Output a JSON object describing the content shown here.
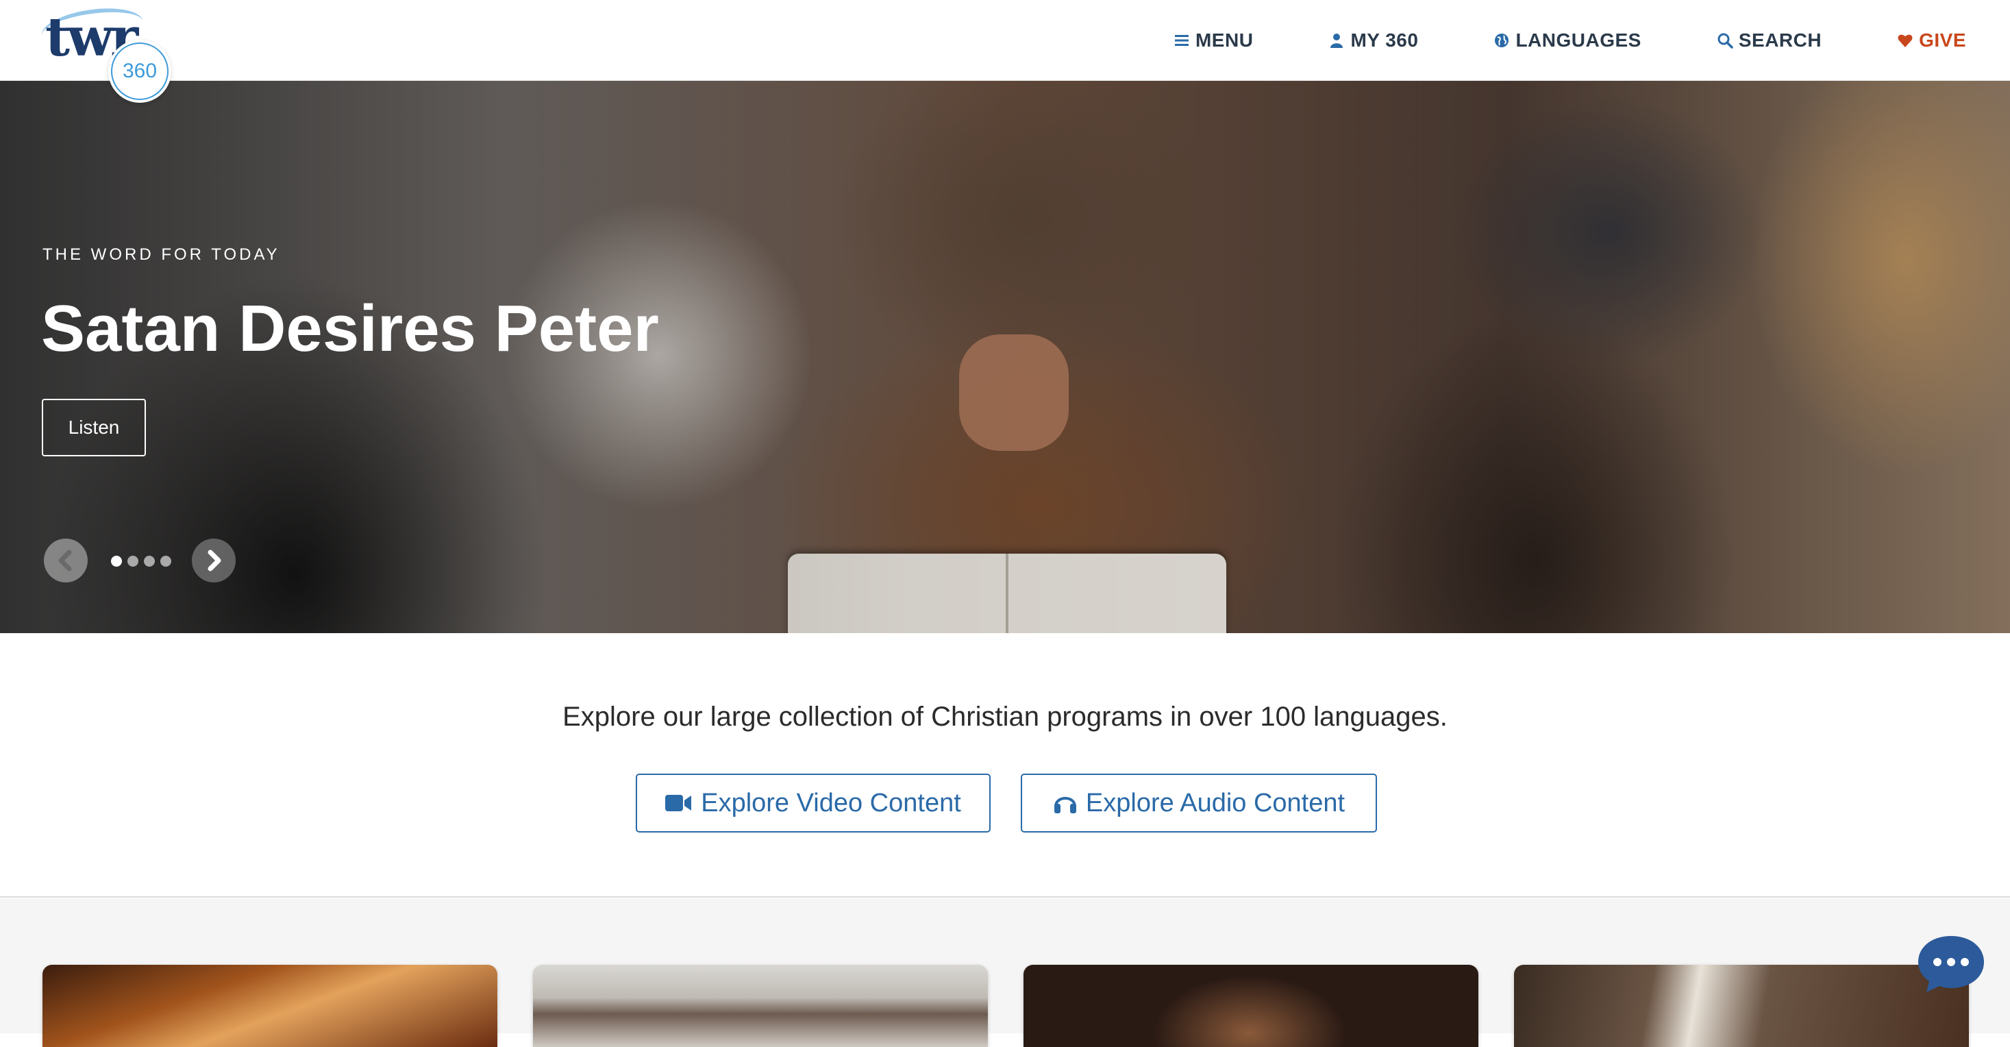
{
  "header": {
    "logo": {
      "text": "twr",
      "badge": "360"
    },
    "nav": [
      {
        "label": "MENU",
        "icon": "bars-icon"
      },
      {
        "label": "MY 360",
        "icon": "user-icon"
      },
      {
        "label": "LANGUAGES",
        "icon": "globe-icon"
      },
      {
        "label": "SEARCH",
        "icon": "search-icon"
      },
      {
        "label": "GIVE",
        "icon": "heart-icon"
      }
    ]
  },
  "hero": {
    "kicker": "THE WORD FOR TODAY",
    "title": "Satan Desires Peter",
    "button": "Listen",
    "slide_count": 4,
    "active_slide": 1
  },
  "explore": {
    "text": "Explore our large collection of Christian programs in over 100 languages.",
    "video_button": "Explore Video Content",
    "audio_button": "Explore Audio Content"
  },
  "colors": {
    "brand_navy": "#1d3b6b",
    "accent_blue": "#2a6aa8",
    "give_orange": "#c9471d",
    "chat_blue": "#2c5a9a"
  }
}
